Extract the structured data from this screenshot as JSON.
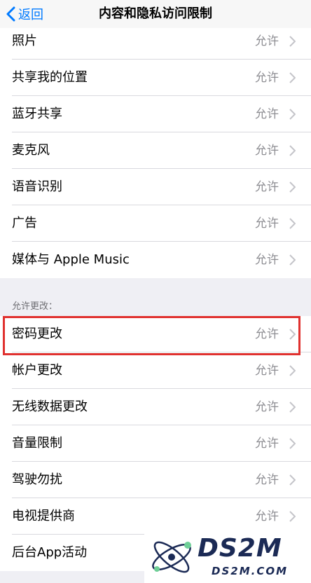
{
  "nav": {
    "back_label": "返回",
    "title": "内容和隐私访问限制"
  },
  "group1": {
    "items": [
      {
        "label": "照片",
        "value": "允许"
      },
      {
        "label": "共享我的位置",
        "value": "允许"
      },
      {
        "label": "蓝牙共享",
        "value": "允许"
      },
      {
        "label": "麦克风",
        "value": "允许"
      },
      {
        "label": "语音识别",
        "value": "允许"
      },
      {
        "label": "广告",
        "value": "允许"
      },
      {
        "label": "媒体与 Apple Music",
        "value": "允许"
      }
    ]
  },
  "group2": {
    "header": "允许更改：",
    "items": [
      {
        "label": "密码更改",
        "value": "允许"
      },
      {
        "label": "帐户更改",
        "value": "允许"
      },
      {
        "label": "无线数据更改",
        "value": "允许"
      },
      {
        "label": "音量限制",
        "value": "允许"
      },
      {
        "label": "驾驶勿扰",
        "value": "允许"
      },
      {
        "label": "电视提供商",
        "value": "允许"
      },
      {
        "label": "后台App活动",
        "value": ""
      }
    ]
  },
  "watermark": {
    "logo": "DS2M",
    "url": "DS2M.COM"
  },
  "colors": {
    "accent": "#007aff",
    "highlight": "#e0312f",
    "value_gray": "#8e8e93"
  }
}
